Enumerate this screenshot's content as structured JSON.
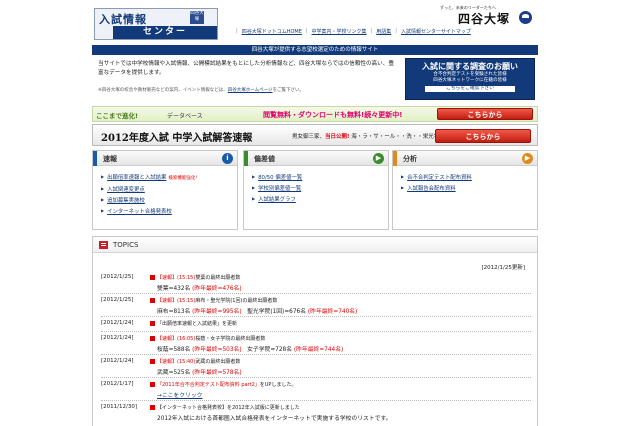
{
  "header": {
    "logo_line1": "入試情報",
    "logo_badge": "四谷大塚",
    "logo_line2": "センター",
    "brand_tagline": "ずっと、未来のリーダーたちへ",
    "brand_name": "四谷大塚"
  },
  "nav": {
    "items": [
      {
        "label": "四谷大塚ドットコムHOME"
      },
      {
        "label": "中学案内・学校リンク集"
      },
      {
        "label": "用語集"
      },
      {
        "label": "入試情報センターサイトマップ"
      }
    ]
  },
  "site_bar": "四谷大塚が提供する志望校選定のための情報サイト",
  "intro": {
    "text": "当サイトでは中学校情報や入試情報、公開模試結果をもとにした分析情報など、四谷大塚ならではの信頼性の高い、豊富なデータを提供します。",
    "note": "※四谷大塚の校舎や教材販売などの案内、イベント情報などは、",
    "note_link": "四谷大塚ホームページ",
    "note_suffix": "をご覧下さい。"
  },
  "survey": {
    "title": "入試に関する調査のお願い",
    "line1": "合不合判定テストを受験された皆様",
    "line2": "四谷大塚ネットワークに在籍の皆様",
    "cta": "こちらをご確認下さい"
  },
  "banner1": {
    "logo": "ここまで進化!",
    "db_label": "データベース",
    "message": "閲覧無料・ダウンロードも無料!続々更新中!",
    "button": "こちらから"
  },
  "banner2": {
    "title": "2012年度入試 中学入試解答速報",
    "sub_prefix": "男女御三家、",
    "sub_highlight": "当日公開!",
    "sub_suffix": " 海・ラ・サ・ール・・洗・・栄光学校など",
    "button": "こちらから"
  },
  "panels": {
    "sokuho": {
      "title": "速報",
      "icon": "i",
      "items": [
        {
          "label": "出願倍率速報と入試結果",
          "tag": "検索機能強化!"
        },
        {
          "label": "入試関連変更点",
          "tag": ""
        },
        {
          "label": "追加募集実施校",
          "tag": ""
        },
        {
          "label": "インターネット合格発表校",
          "tag": ""
        }
      ]
    },
    "hensachi": {
      "title": "偏差値",
      "icon": "▶",
      "items": [
        {
          "label": "80/50 偏差値一覧",
          "tag": ""
        },
        {
          "label": "学校別偏差値一覧",
          "tag": ""
        },
        {
          "label": "入試結果グラフ",
          "tag": ""
        }
      ]
    },
    "bunseki": {
      "title": "分析",
      "icon": "▶",
      "items": [
        {
          "label": "合不合判定テスト配布資料",
          "tag": ""
        },
        {
          "label": "入試報告会配布資料",
          "tag": ""
        }
      ]
    }
  },
  "topics": {
    "title": "TOPICS",
    "updated": "[2012/1/25更新]",
    "items": [
      {
        "date": "[2012/1/25]",
        "line1_tag": "【速報】(15:15)",
        "line1": "雙葉の最終出願者数",
        "line2": "雙葉=432名",
        "line2_red": "(昨年最終=476名)"
      },
      {
        "date": "[2012/1/25]",
        "line1_tag": "【速報】(15:15)",
        "line1": "麻布・聖光学院(1回)の最終出願者数",
        "line2": "麻布=813名",
        "line2_red": "(昨年最終=995名)",
        "line3": "聖光学院(1回)=676名",
        "line3_red": "(昨年最終=740名)"
      },
      {
        "date": "[2012/1/24]",
        "line1_tag": "",
        "line1": "「出願倍率速報と入試結果」を更新"
      },
      {
        "date": "[2012/1/24]",
        "line1_tag": "【速報】(16:05)",
        "line1": "桜蔭・女子学院の最終出願者数",
        "line2": "桜蔭=588名",
        "line2_red": "(昨年最終=503名)",
        "line3": "女子学院=728名",
        "line3_red": "(昨年最終=744名)"
      },
      {
        "date": "[2012/1/24]",
        "line1_tag": "【速報】(15:40)",
        "line1": "武蔵の最終出願者数",
        "line2": "武蔵=525名",
        "line2_red": "(昨年最終=578名)"
      },
      {
        "date": "[2012/1/17]",
        "line1_tag": "",
        "line1_link": "「2011年合不合判定テスト配布資料 part2」",
        "line1": "をUPしました。",
        "line2_link": "→ここをクリック"
      },
      {
        "date": "[2011/12/30]",
        "line1_tag": "",
        "line1": "【インターネット合格発表校】を2012年入試版に更新しました",
        "line2": "2012年入試における首都圏入試合格発表をインターネットで実施する学校のリストです。"
      }
    ]
  },
  "colors": {
    "navy": "#123a7a",
    "sokuho_accent": "#1a5ba8",
    "hensachi_accent": "#3b8a2f",
    "bunseki_accent": "#e08a1e",
    "red": "#e00000"
  }
}
